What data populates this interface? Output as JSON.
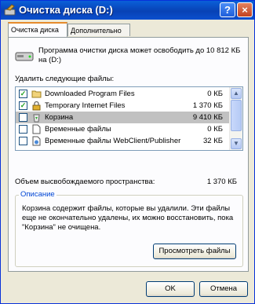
{
  "window": {
    "title": "Очистка диска (D:)",
    "help_glyph": "?",
    "close_glyph": "×"
  },
  "tabs": [
    {
      "label": "Очистка диска",
      "active": true
    },
    {
      "label": "Дополнительно",
      "active": false
    }
  ],
  "intro_text": "Программа очистки диска может освободить до 10 812 КБ на (D:)",
  "list_label": "Удалить следующие файлы:",
  "files": [
    {
      "name": "Downloaded Program Files",
      "size": "0 КБ",
      "checked": true,
      "selected": false,
      "icon": "folder-icon"
    },
    {
      "name": "Temporary Internet Files",
      "size": "1 370 КБ",
      "checked": true,
      "selected": false,
      "icon": "lock-icon"
    },
    {
      "name": "Корзина",
      "size": "9 410 КБ",
      "checked": false,
      "selected": true,
      "icon": "recycle-bin-icon"
    },
    {
      "name": "Временные файлы",
      "size": "0 КБ",
      "checked": false,
      "selected": false,
      "icon": "temp-files-icon"
    },
    {
      "name": "Временные файлы WebClient/Publisher",
      "size": "32 КБ",
      "checked": false,
      "selected": false,
      "icon": "webclient-icon"
    }
  ],
  "total_label": "Объем высвобождаемого пространства:",
  "total_value": "1 370 КБ",
  "description_group": {
    "title": "Описание",
    "text": "Корзина содержит файлы, которые вы удалили. Эти файлы еще не окончательно удалены, их можно восстановить, пока \"Корзина\" не очищена."
  },
  "buttons": {
    "view_files": "Просмотреть файлы",
    "ok": "OK",
    "cancel": "Отмена"
  },
  "colors": {
    "title_bar": "#0842b5",
    "selected_row": "#c1c1c1",
    "check": "#21a121"
  }
}
